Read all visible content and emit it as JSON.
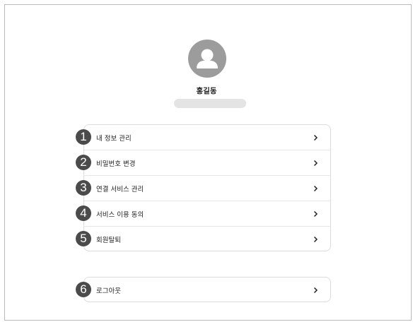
{
  "profile": {
    "name": "홍길동",
    "avatar_icon": "user-silhouette-icon"
  },
  "menu": [
    {
      "badge": "1",
      "label": "내 정보 관리"
    },
    {
      "badge": "2",
      "label": "비밀번호 변경"
    },
    {
      "badge": "3",
      "label": "연결 서비스 관리"
    },
    {
      "badge": "4",
      "label": "서비스 이용 동의"
    },
    {
      "badge": "5",
      "label": "회원탈퇴"
    }
  ],
  "logout": {
    "badge": "6",
    "label": "로그아웃"
  },
  "icons": {
    "chevron": "chevron-right-icon"
  },
  "colors": {
    "badge": "#4b4b4b",
    "avatar": "#9c9c9c",
    "border": "#dcdcdc",
    "placeholder": "#e4e4e4"
  }
}
